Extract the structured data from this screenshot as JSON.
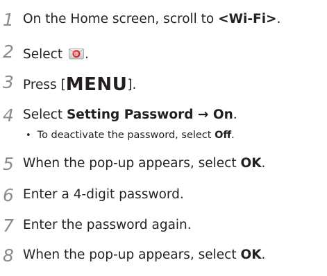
{
  "steps": [
    {
      "num": "1",
      "pre": "On the Home screen, scroll to ",
      "bold": "<Wi-Fi>",
      "post": "."
    },
    {
      "num": "2",
      "pre": "Select ",
      "icon": "mail-icon",
      "post": "."
    },
    {
      "num": "3",
      "pre": "Press [",
      "key": "MENU",
      "post": "]."
    },
    {
      "num": "4",
      "pre": "Select ",
      "bold": "Setting Password",
      "mid": " → ",
      "bold2": "On",
      "post": ".",
      "sub": {
        "bullet": "•",
        "pre": "To deactivate the password, select ",
        "bold": "Off",
        "post": "."
      }
    },
    {
      "num": "5",
      "pre": " When the pop-up appears, select ",
      "bold": "OK",
      "post": "."
    },
    {
      "num": "6",
      "text": "Enter a 4-digit password."
    },
    {
      "num": "7",
      "text": "Enter the password again."
    },
    {
      "num": "8",
      "pre": "When the pop-up appears, select ",
      "bold": "OK",
      "post": "."
    }
  ],
  "colors": {
    "number": "#8c8c8c",
    "text": "#231f20",
    "icon_red": "#d8283a"
  }
}
